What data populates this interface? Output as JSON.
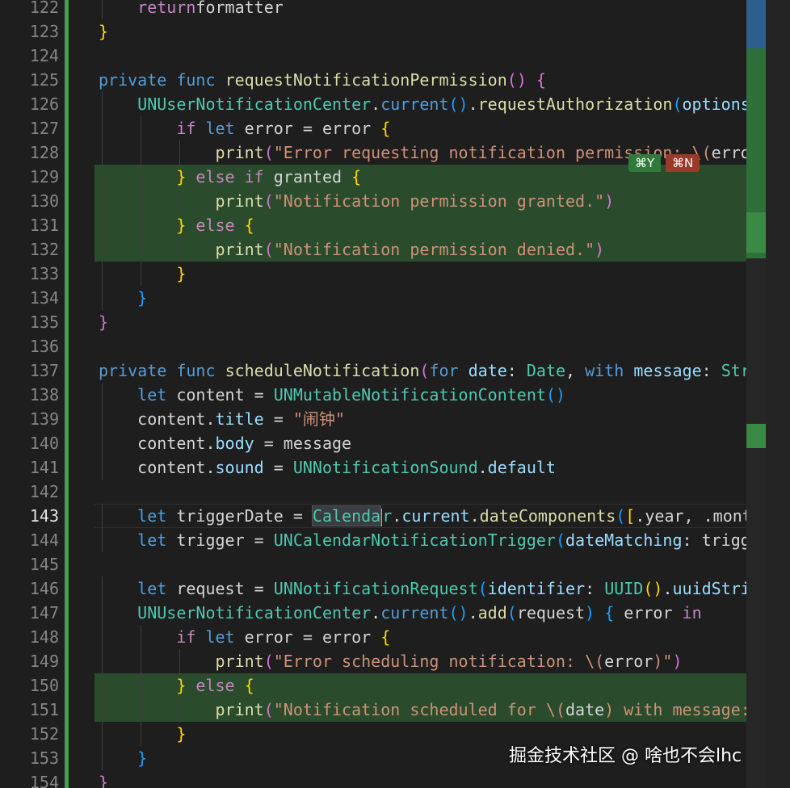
{
  "editor": {
    "lines": [
      {
        "num": "122",
        "tokens": [
          [
            "",
            "    "
          ],
          [
            "kc",
            "return"
          ],
          [
            "",
            "formatter"
          ]
        ]
      },
      {
        "num": "123",
        "tokens": [
          [
            "b1",
            "}"
          ]
        ]
      },
      {
        "num": "124",
        "tokens": []
      },
      {
        "num": "125",
        "tokens": [
          [
            "k",
            "private"
          ],
          [
            "",
            " "
          ],
          [
            "k",
            "func"
          ],
          [
            "",
            " "
          ],
          [
            "fn",
            "requestNotificationPermission"
          ],
          [
            "b2",
            "("
          ],
          [
            "b2",
            ")"
          ],
          [
            "",
            " "
          ],
          [
            "b2",
            "{"
          ]
        ]
      },
      {
        "num": "126",
        "tokens": [
          [
            "",
            "    "
          ],
          [
            "ty",
            "UNUserNotificationCenter"
          ],
          [
            "",
            "."
          ],
          [
            "k",
            "current"
          ],
          [
            "b3",
            "("
          ],
          [
            "b3",
            ")"
          ],
          [
            "",
            "."
          ],
          [
            "fn",
            "requestAuthorization"
          ],
          [
            "b3",
            "("
          ],
          [
            "pm",
            "options"
          ],
          [
            "",
            ":"
          ]
        ]
      },
      {
        "num": "127",
        "tokens": [
          [
            "",
            "        "
          ],
          [
            "kc",
            "if"
          ],
          [
            "",
            " "
          ],
          [
            "k",
            "let"
          ],
          [
            "",
            " error = error "
          ],
          [
            "b1",
            "{"
          ]
        ]
      },
      {
        "num": "128",
        "tokens": [
          [
            "",
            "            "
          ],
          [
            "fn",
            "print"
          ],
          [
            "b2",
            "("
          ],
          [
            "st",
            "\"Error requesting notification permission: \\("
          ],
          [
            "",
            "error"
          ],
          [
            "st",
            ")"
          ]
        ]
      },
      {
        "num": "129",
        "tokens": [
          [
            "",
            "        "
          ],
          [
            "b1",
            "}"
          ],
          [
            "",
            " "
          ],
          [
            "kc",
            "else if"
          ],
          [
            "",
            " granted "
          ],
          [
            "b1",
            "{"
          ]
        ]
      },
      {
        "num": "130",
        "tokens": [
          [
            "",
            "            "
          ],
          [
            "fn",
            "print"
          ],
          [
            "b2",
            "("
          ],
          [
            "st",
            "\"Notification permission granted.\""
          ],
          [
            "b2",
            ")"
          ]
        ]
      },
      {
        "num": "131",
        "tokens": [
          [
            "",
            "        "
          ],
          [
            "b1",
            "}"
          ],
          [
            "",
            " "
          ],
          [
            "kc",
            "else"
          ],
          [
            "",
            " "
          ],
          [
            "b1",
            "{"
          ]
        ]
      },
      {
        "num": "132",
        "tokens": [
          [
            "",
            "            "
          ],
          [
            "fn",
            "print"
          ],
          [
            "b2",
            "("
          ],
          [
            "st",
            "\"Notification permission denied.\""
          ],
          [
            "b2",
            ")"
          ]
        ]
      },
      {
        "num": "133",
        "tokens": [
          [
            "",
            "        "
          ],
          [
            "b1",
            "}"
          ]
        ]
      },
      {
        "num": "134",
        "tokens": [
          [
            "",
            "    "
          ],
          [
            "b3",
            "}"
          ]
        ]
      },
      {
        "num": "135",
        "tokens": [
          [
            "b2",
            "}"
          ]
        ]
      },
      {
        "num": "136",
        "tokens": []
      },
      {
        "num": "137",
        "tokens": [
          [
            "k",
            "private"
          ],
          [
            "",
            " "
          ],
          [
            "k",
            "func"
          ],
          [
            "",
            " "
          ],
          [
            "fn",
            "scheduleNotification"
          ],
          [
            "b2",
            "("
          ],
          [
            "k",
            "for"
          ],
          [
            "",
            " "
          ],
          [
            "pm",
            "date"
          ],
          [
            "",
            ": "
          ],
          [
            "ty",
            "Date"
          ],
          [
            "",
            ", "
          ],
          [
            "k",
            "with"
          ],
          [
            "",
            " "
          ],
          [
            "pm",
            "message"
          ],
          [
            "",
            ": "
          ],
          [
            "ty",
            "Str"
          ]
        ]
      },
      {
        "num": "138",
        "tokens": [
          [
            "",
            "    "
          ],
          [
            "k",
            "let"
          ],
          [
            "",
            " content = "
          ],
          [
            "ty",
            "UNMutableNotificationContent"
          ],
          [
            "b3",
            "("
          ],
          [
            "b3",
            ")"
          ]
        ]
      },
      {
        "num": "139",
        "tokens": [
          [
            "",
            "    content."
          ],
          [
            "pm",
            "title"
          ],
          [
            "",
            " = "
          ],
          [
            "st",
            "\"闹钟\""
          ]
        ]
      },
      {
        "num": "140",
        "tokens": [
          [
            "",
            "    content."
          ],
          [
            "pm",
            "body"
          ],
          [
            "",
            " = message"
          ]
        ]
      },
      {
        "num": "141",
        "tokens": [
          [
            "",
            "    content."
          ],
          [
            "pm",
            "sound"
          ],
          [
            "",
            " = "
          ],
          [
            "ty",
            "UNNotificationSound"
          ],
          [
            "",
            "."
          ],
          [
            "pm",
            "default"
          ]
        ]
      },
      {
        "num": "142",
        "tokens": []
      },
      {
        "num": "143",
        "tokens": [
          [
            "",
            "    "
          ],
          [
            "k",
            "let"
          ],
          [
            "",
            " triggerDate = "
          ],
          [
            "sel",
            "Calenda"
          ],
          [
            "cur",
            ""
          ],
          [
            "ty",
            "r"
          ],
          [
            "",
            "."
          ],
          [
            "pm",
            "current"
          ],
          [
            "",
            "."
          ],
          [
            "fn",
            "dateComponents"
          ],
          [
            "b3",
            "("
          ],
          [
            "b1",
            "["
          ],
          [
            "",
            ".year, .month,"
          ]
        ]
      },
      {
        "num": "144",
        "tokens": [
          [
            "",
            "    "
          ],
          [
            "k",
            "let"
          ],
          [
            "",
            " trigger = "
          ],
          [
            "ty",
            "UNCalendarNotificationTrigger"
          ],
          [
            "b3",
            "("
          ],
          [
            "pm",
            "dateMatching"
          ],
          [
            "",
            ": trigger"
          ]
        ]
      },
      {
        "num": "145",
        "tokens": []
      },
      {
        "num": "146",
        "tokens": [
          [
            "",
            "    "
          ],
          [
            "k",
            "let"
          ],
          [
            "",
            " request = "
          ],
          [
            "ty",
            "UNNotificationRequest"
          ],
          [
            "b3",
            "("
          ],
          [
            "pm",
            "identifier"
          ],
          [
            "",
            ": "
          ],
          [
            "ty",
            "UUID"
          ],
          [
            "b1",
            "("
          ],
          [
            "b1",
            ")"
          ],
          [
            "",
            "."
          ],
          [
            "pm",
            "uuidString"
          ]
        ]
      },
      {
        "num": "147",
        "tokens": [
          [
            "",
            "    "
          ],
          [
            "ty",
            "UNUserNotificationCenter"
          ],
          [
            "",
            "."
          ],
          [
            "k",
            "current"
          ],
          [
            "b3",
            "("
          ],
          [
            "b3",
            ")"
          ],
          [
            "",
            "."
          ],
          [
            "fn",
            "add"
          ],
          [
            "b3",
            "("
          ],
          [
            "",
            "request"
          ],
          [
            "b3",
            ")"
          ],
          [
            "",
            " "
          ],
          [
            "b3",
            "{"
          ],
          [
            "",
            " error "
          ],
          [
            "kc",
            "in"
          ]
        ]
      },
      {
        "num": "148",
        "tokens": [
          [
            "",
            "        "
          ],
          [
            "kc",
            "if"
          ],
          [
            "",
            " "
          ],
          [
            "k",
            "let"
          ],
          [
            "",
            " error = error "
          ],
          [
            "b1",
            "{"
          ]
        ]
      },
      {
        "num": "149",
        "tokens": [
          [
            "",
            "            "
          ],
          [
            "fn",
            "print"
          ],
          [
            "b2",
            "("
          ],
          [
            "st",
            "\"Error scheduling notification: \\("
          ],
          [
            "",
            "error"
          ],
          [
            "st",
            ")\""
          ],
          [
            "b2",
            ")"
          ]
        ]
      },
      {
        "num": "150",
        "tokens": [
          [
            "",
            "        "
          ],
          [
            "b1",
            "}"
          ],
          [
            "",
            " "
          ],
          [
            "kc",
            "else"
          ],
          [
            "",
            " "
          ],
          [
            "b1",
            "{"
          ]
        ]
      },
      {
        "num": "151",
        "tokens": [
          [
            "",
            "            "
          ],
          [
            "fn",
            "print"
          ],
          [
            "b2",
            "("
          ],
          [
            "st",
            "\"Notification scheduled for \\("
          ],
          [
            "",
            "date"
          ],
          [
            "st",
            ") with message: \\"
          ]
        ]
      },
      {
        "num": "152",
        "tokens": [
          [
            "",
            "        "
          ],
          [
            "b1",
            "}"
          ]
        ]
      },
      {
        "num": "153",
        "tokens": [
          [
            "",
            "    "
          ],
          [
            "b3",
            "}"
          ]
        ]
      },
      {
        "num": "154",
        "tokens": [
          [
            "b2",
            "}"
          ]
        ]
      }
    ],
    "added_lines": [
      "129",
      "130",
      "131",
      "132",
      "150",
      "151"
    ],
    "current_line": "143"
  },
  "inline_chat": {
    "accept_label": "⌘Y",
    "reject_label": "⌘N"
  },
  "watermark": {
    "text": "掘金技术社区 @ 啥也不会lhc"
  }
}
